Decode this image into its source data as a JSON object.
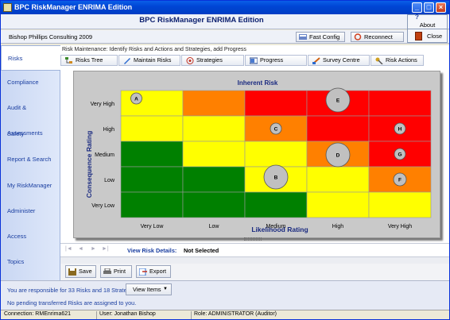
{
  "window": {
    "title": "BPC RiskManager ENRIMA Edition",
    "min": "_",
    "max": "□",
    "close": "×"
  },
  "header": {
    "app_title": "BPC RiskManager ENRIMA Edition",
    "company": "Bishop Phillips Consulting 2009",
    "about": "About",
    "fast_config": "Fast Config",
    "reconnect": "Reconnect",
    "close": "Close"
  },
  "sidebar": {
    "items": [
      {
        "label": "Risks",
        "active": true
      },
      {
        "label": "Compliance"
      },
      {
        "label": "Audit & Assessments"
      },
      {
        "label": "Safety"
      },
      {
        "label": "Report & Search"
      },
      {
        "label": "My RiskManager"
      },
      {
        "label": "Administer"
      },
      {
        "label": "Access"
      },
      {
        "label": "Topics"
      }
    ]
  },
  "main": {
    "breadcrumb": "Risk Maintenance:  Identify Risks and Actions and Strategies, add Progress",
    "tabs": [
      {
        "label": "Risks Tree"
      },
      {
        "label": "Maintain Risks"
      },
      {
        "label": "Strategies"
      },
      {
        "label": "Progress"
      },
      {
        "label": "Survey Centre"
      },
      {
        "label": "Risk Actions"
      }
    ],
    "nav": {
      "label": "View Risk Details:",
      "value": "Not Selected"
    },
    "actions": {
      "save": "Save",
      "print": "Print",
      "export": "Export"
    }
  },
  "info": {
    "line1": "You are responsible for 33 Risks and 18 Strategies",
    "line2": "No pending transferred Risks are assigned to you.",
    "view_items": "View Items"
  },
  "status": {
    "connection": "Connection: RMEnrima621",
    "user": "User: Jonathan Bishop",
    "role": "Role: ADMINISTRATOR (Auditor)"
  },
  "colors": {
    "red": "#ff0000",
    "orange": "#ff8000",
    "yellow": "#ffff00",
    "green": "#008000",
    "bubble": "#c0c0c0"
  },
  "chart_data": {
    "type": "heatmap",
    "title": "Inherent Risk",
    "xlabel": "Likelihood Rating",
    "ylabel": "Consequence Rating",
    "x_categories": [
      "Very Low",
      "Low",
      "Medium",
      "High",
      "Very High"
    ],
    "y_categories": [
      "Very High",
      "High",
      "Medium",
      "Low",
      "Very Low"
    ],
    "cells": [
      [
        "yellow",
        "orange",
        "red",
        "red",
        "red"
      ],
      [
        "yellow",
        "yellow",
        "orange",
        "red",
        "red"
      ],
      [
        "green",
        "yellow",
        "yellow",
        "orange",
        "red"
      ],
      [
        "green",
        "green",
        "yellow",
        "yellow",
        "orange"
      ],
      [
        "green",
        "green",
        "green",
        "yellow",
        "yellow"
      ]
    ],
    "bubbles": [
      {
        "label": "A",
        "x": "Very Low",
        "y": "Very High",
        "size": 1
      },
      {
        "label": "E",
        "x": "High",
        "y": "Very High",
        "size": 3
      },
      {
        "label": "C",
        "x": "Medium",
        "y": "High",
        "size": 1
      },
      {
        "label": "H",
        "x": "Very High",
        "y": "High",
        "size": 1
      },
      {
        "label": "D",
        "x": "High",
        "y": "Medium",
        "size": 3
      },
      {
        "label": "G",
        "x": "Very High",
        "y": "Medium",
        "size": 1
      },
      {
        "label": "B",
        "x": "Medium",
        "y": "Low",
        "size": 3
      },
      {
        "label": "F",
        "x": "Very High",
        "y": "Low",
        "size": 1.2
      }
    ]
  }
}
